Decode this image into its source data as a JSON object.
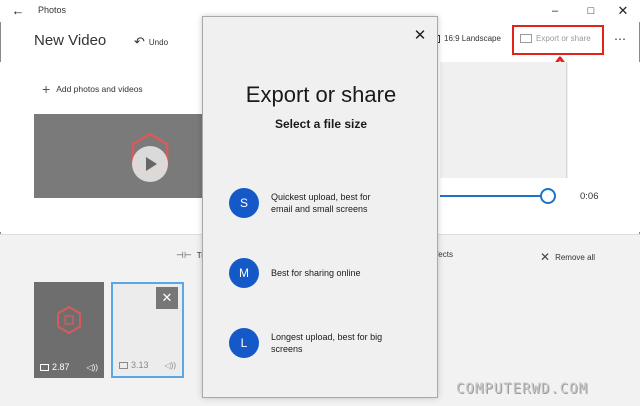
{
  "window": {
    "title": "Photos",
    "back_glyph": "←",
    "minimize_glyph": "–",
    "maximize_glyph": "□",
    "close_glyph": "✕"
  },
  "toolbar": {
    "project_title": "New Video",
    "undo_label": "Undo",
    "aspect_label": "16:9 Landscape",
    "export_label": "Export or share",
    "more_glyph": "⋯"
  },
  "library": {
    "add_label": "Add photos and videos"
  },
  "preview": {
    "duration": "0:06",
    "progress": 1.0
  },
  "storyboard": {
    "trim_label": "Tr",
    "effects_label": "ffects",
    "remove_all_label": "Remove all",
    "clips": [
      {
        "duration": "2.87"
      },
      {
        "duration": "3.13"
      }
    ]
  },
  "dialog": {
    "title": "Export or share",
    "subtitle": "Select a file size",
    "options": [
      {
        "badge": "S",
        "desc_line1": "Quickest upload, best for",
        "desc_line2": "email and small screens"
      },
      {
        "badge": "M",
        "desc_line1": "Best for sharing online",
        "desc_line2": ""
      },
      {
        "badge": "L",
        "desc_line1": "Longest upload, best for big",
        "desc_line2": "screens"
      }
    ]
  },
  "watermark": "COMPUTERWD.COM",
  "colors": {
    "accent": "#1559c9",
    "highlight": "#e2231a",
    "seek": "#1e73c8"
  }
}
